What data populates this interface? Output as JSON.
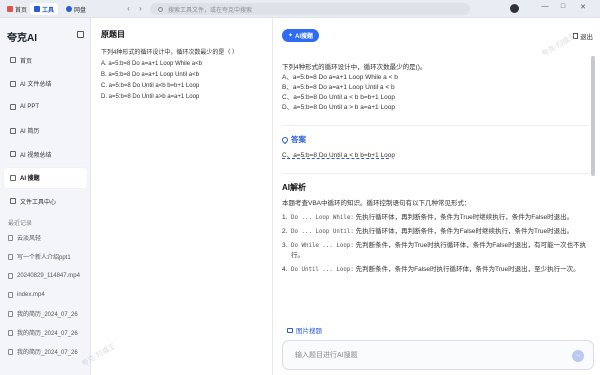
{
  "tabs": [
    {
      "label": "首页",
      "icon": "home-icon",
      "color": "#e0554a"
    },
    {
      "label": "工具",
      "icon": "tools-icon",
      "color": "#2a5bd7",
      "active": true
    },
    {
      "label": "网盘",
      "icon": "cloud-icon",
      "color": "#2a5bd7"
    }
  ],
  "search": {
    "placeholder": "搜索工具文件，或在夸克中搜索"
  },
  "window": {
    "minimize": "—",
    "maximize": "□",
    "close": "✕"
  },
  "sidebar": {
    "brand": "夸克AI",
    "items": [
      {
        "label": "首页",
        "icon": "home-icon"
      },
      {
        "label": "AI 文件总结",
        "icon": "file-summary-icon"
      },
      {
        "label": "AI PPT",
        "icon": "ppt-icon"
      },
      {
        "label": "AI 简历",
        "icon": "resume-icon"
      },
      {
        "label": "AI 视频总结",
        "icon": "video-icon"
      },
      {
        "label": "AI 搜题",
        "icon": "question-icon",
        "active": true
      },
      {
        "label": "文件工具中心",
        "icon": "toolbox-icon"
      }
    ],
    "recent_title": "最近记录",
    "recent": [
      "云淡风轻",
      "写一个新人介绍ppt1",
      "20240829_114847.mp4",
      "index.mp4",
      "我的简历_2024_07_26",
      "我的简历_2024_07_26",
      "我的简历_2024_07_26"
    ]
  },
  "original": {
    "title": "原题目",
    "lines": [
      "下列4种形式的循环设计中，循环次数最少的是（ ）",
      "A. a=5:b=8 Do a=a+1 Loop While a<b",
      "B. a=5:b=8 Do a=a+1 Loop Until a<b",
      "C. a=5:b=8 Do Until a<b b=b+1 Loop",
      "D. a=5:b=8 Do Until a>b a=a+1 Loop"
    ]
  },
  "ai": {
    "badge": "AI搜题",
    "exit": "退出",
    "question": [
      "下列4种形式的循环设计中，循环次数最少的是()。",
      "A、a=5:b=8 Do a=a+1 Loop While a < b",
      "B、a=5:b=8 Do a=a+1 Loop Until a < b",
      "C、a=5:b=8 Do Until a < b b=b+1 Loop",
      "D、a=5:b=8 Do Until a > b a=a+1 Loop"
    ],
    "answer_title": "答案",
    "answer": "C、a=5:b=8 Do Until a < b b=b+1 Loop",
    "analysis_title": "AI解析",
    "analysis_intro": "本题考查VBA中循环的知识。循环控制语句有以下几种常见形式：",
    "analysis_items": [
      {
        "num": "1.",
        "code": "Do ... Loop While:",
        "text": "先执行循环体，再判断条件，条件为True时继续执行，条件为False时退出。"
      },
      {
        "num": "2.",
        "code": "Do ... Loop Until:",
        "text": "先执行循环体，再判断条件，条件为False时继续执行，条件为True时退出。"
      },
      {
        "num": "3.",
        "code": "Do While ... Loop:",
        "text": "先判断条件，条件为True时执行循环体，条件为False时退出，有可能一次也不执行。"
      },
      {
        "num": "4.",
        "code": "Do Until ... Loop:",
        "text": "先判断条件，条件为False时执行循环体，条件为True时退出，至少执行一次。"
      }
    ],
    "image_search": "图片搜题",
    "input_placeholder": "输入题目进行AI搜题",
    "send": "→"
  },
  "watermark": "夸克·扫描王"
}
